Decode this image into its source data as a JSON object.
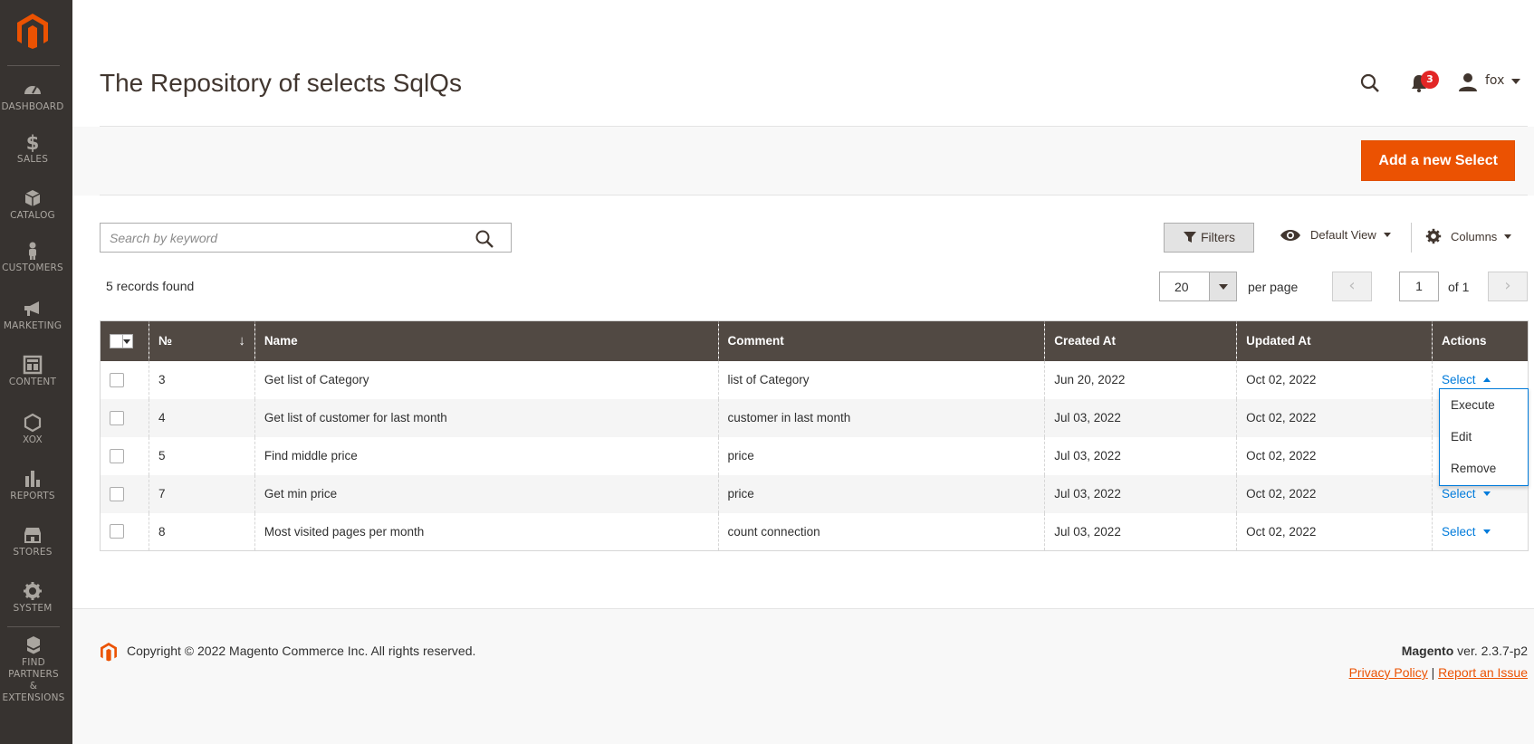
{
  "sidebar": {
    "items": [
      {
        "label": "DASHBOARD",
        "icon": "dashboard-icon"
      },
      {
        "label": "SALES",
        "icon": "dollar-icon"
      },
      {
        "label": "CATALOG",
        "icon": "cube-icon"
      },
      {
        "label": "CUSTOMERS",
        "icon": "person-icon"
      },
      {
        "label": "MARKETING",
        "icon": "megaphone-icon"
      },
      {
        "label": "CONTENT",
        "icon": "layout-icon"
      },
      {
        "label": "XOX",
        "icon": "hexagon-icon"
      },
      {
        "label": "REPORTS",
        "icon": "bar-chart-icon"
      },
      {
        "label": "STORES",
        "icon": "store-icon"
      },
      {
        "label": "SYSTEM",
        "icon": "gear-icon"
      }
    ],
    "partners_line1": "FIND PARTNERS",
    "partners_line2": "& EXTENSIONS"
  },
  "header": {
    "title": "The Repository of selects SqlQs",
    "notifications_count": "3",
    "user_name": "fox"
  },
  "actions": {
    "add_label": "Add a new Select"
  },
  "toolbar": {
    "search_placeholder": "Search by keyword",
    "filters_label": "Filters",
    "view_label": "Default View",
    "columns_label": "Columns",
    "records_found": "5 records found",
    "per_page_value": "20",
    "per_page_label": "per page",
    "page_current": "1",
    "page_of": "of 1"
  },
  "table": {
    "headers": {
      "id": "№",
      "name": "Name",
      "comment": "Comment",
      "created": "Created At",
      "updated": "Updated At",
      "actions": "Actions"
    },
    "action_label": "Select",
    "rows": [
      {
        "id": "3",
        "name": "Get list of Category",
        "comment": "list of Category",
        "created": "Jun 20, 2022",
        "updated": "Oct 02, 2022"
      },
      {
        "id": "4",
        "name": "Get list of customer for last month",
        "comment": "customer in last month",
        "created": "Jul 03, 2022",
        "updated": "Oct 02, 2022"
      },
      {
        "id": "5",
        "name": "Find middle price",
        "comment": "price",
        "created": "Jul 03, 2022",
        "updated": "Oct 02, 2022"
      },
      {
        "id": "7",
        "name": "Get min price",
        "comment": "price",
        "created": "Jul 03, 2022",
        "updated": "Oct 02, 2022"
      },
      {
        "id": "8",
        "name": "Most visited pages per month",
        "comment": "count connection",
        "created": "Jul 03, 2022",
        "updated": "Oct 02, 2022"
      }
    ],
    "action_menu": [
      "Execute",
      "Edit",
      "Remove"
    ]
  },
  "footer": {
    "copyright": "Copyright © 2022 Magento Commerce Inc. All rights reserved.",
    "brand": "Magento",
    "version": " ver. 2.3.7-p2",
    "privacy": "Privacy Policy",
    "separator": " | ",
    "report": "Report an Issue"
  },
  "colors": {
    "sidebar_bg": "#373330",
    "accent": "#eb5202",
    "table_header": "#514943",
    "link": "#007bdb"
  }
}
